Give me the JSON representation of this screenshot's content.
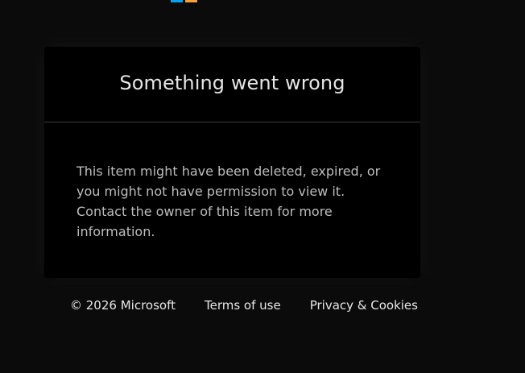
{
  "card": {
    "title": "Something went wrong",
    "message": "This item might have been deleted, expired, or you might not have permission to view it. Contact the owner of this item for more information."
  },
  "footer": {
    "copyright": "© 2026 Microsoft",
    "terms_label": "Terms of use",
    "privacy_label": "Privacy & Cookies"
  },
  "colors": {
    "background": "#0b0b0b",
    "card_background": "#000000",
    "divider": "#3a3a3a",
    "title_text": "#e6e6e6",
    "body_text": "#bdbdbd",
    "logo_blue": "#00a4ef",
    "logo_orange": "#f6a13b"
  },
  "icons": {
    "brand_logo": "microsoft-logo-icon"
  }
}
